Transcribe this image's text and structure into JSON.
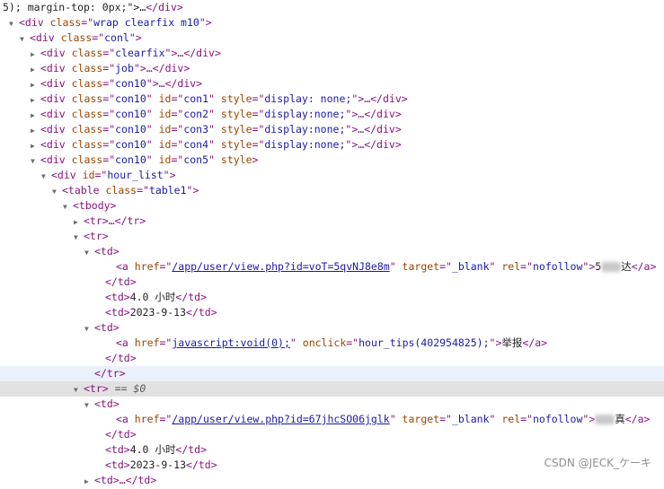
{
  "lines": [
    {
      "indent": 3,
      "tri": "",
      "html": "<span class='txt'>5); margin-top: 0px;\">…</span><span class='tag'>&lt;/div&gt;</span>"
    },
    {
      "indent": 21,
      "tri": "open",
      "html": "<span class='tag'>&lt;div</span> <span class='attr'>class</span>=\"<span class='val'>wrap clearfix m10</span>\"<span class='tag'>&gt;</span>"
    },
    {
      "indent": 33,
      "tri": "open",
      "html": "<span class='tag'>&lt;div</span> <span class='attr'>class</span>=\"<span class='val'>conl</span>\"<span class='tag'>&gt;</span>"
    },
    {
      "indent": 45,
      "tri": "closed",
      "html": "<span class='tag'>&lt;div</span> <span class='attr'>class</span>=\"<span class='val'>clearfix</span>\"<span class='tag'>&gt;</span>…<span class='tag'>&lt;/div&gt;</span>"
    },
    {
      "indent": 45,
      "tri": "closed",
      "html": "<span class='tag'>&lt;div</span> <span class='attr'>class</span>=\"<span class='val'>job</span>\"<span class='tag'>&gt;</span>…<span class='tag'>&lt;/div&gt;</span>"
    },
    {
      "indent": 45,
      "tri": "closed",
      "html": "<span class='tag'>&lt;div</span> <span class='attr'>class</span>=\"<span class='val'>con10</span>\"<span class='tag'>&gt;</span>…<span class='tag'>&lt;/div&gt;</span>"
    },
    {
      "indent": 45,
      "tri": "closed",
      "html": "<span class='tag'>&lt;div</span> <span class='attr'>class</span>=\"<span class='val'>con10</span>\" <span class='attr'>id</span>=\"<span class='val'>con1</span>\" <span class='attr'>style</span>=\"<span class='val'>display: none;</span>\"<span class='tag'>&gt;</span>…<span class='tag'>&lt;/div&gt;</span>"
    },
    {
      "indent": 45,
      "tri": "closed",
      "html": "<span class='tag'>&lt;div</span> <span class='attr'>class</span>=\"<span class='val'>con10</span>\" <span class='attr'>id</span>=\"<span class='val'>con2</span>\" <span class='attr'>style</span>=\"<span class='val'>display:none;</span>\"<span class='tag'>&gt;</span>…<span class='tag'>&lt;/div&gt;</span>"
    },
    {
      "indent": 45,
      "tri": "closed",
      "html": "<span class='tag'>&lt;div</span> <span class='attr'>class</span>=\"<span class='val'>con10</span>\" <span class='attr'>id</span>=\"<span class='val'>con3</span>\" <span class='attr'>style</span>=\"<span class='val'>display:none;</span>\"<span class='tag'>&gt;</span>…<span class='tag'>&lt;/div&gt;</span>"
    },
    {
      "indent": 45,
      "tri": "closed",
      "html": "<span class='tag'>&lt;div</span> <span class='attr'>class</span>=\"<span class='val'>con10</span>\" <span class='attr'>id</span>=\"<span class='val'>con4</span>\" <span class='attr'>style</span>=\"<span class='val'>display:none;</span>\"<span class='tag'>&gt;</span>…<span class='tag'>&lt;/div&gt;</span>"
    },
    {
      "indent": 45,
      "tri": "open",
      "html": "<span class='tag'>&lt;div</span> <span class='attr'>class</span>=\"<span class='val'>con10</span>\" <span class='attr'>id</span>=\"<span class='val'>con5</span>\" <span class='attr'>style</span><span class='tag'>&gt;</span>"
    },
    {
      "indent": 57,
      "tri": "open",
      "html": "<span class='tag'>&lt;div</span> <span class='attr'>id</span>=\"<span class='val'>hour_list</span>\"<span class='tag'>&gt;</span>"
    },
    {
      "indent": 69,
      "tri": "open",
      "html": "<span class='tag'>&lt;table</span> <span class='attr'>class</span>=\"<span class='val'>table1</span>\"<span class='tag'>&gt;</span>"
    },
    {
      "indent": 81,
      "tri": "open",
      "html": "<span class='tag'>&lt;tbody&gt;</span>"
    },
    {
      "indent": 93,
      "tri": "closed",
      "html": "<span class='tag'>&lt;tr&gt;</span>…<span class='tag'>&lt;/tr&gt;</span>"
    },
    {
      "indent": 93,
      "tri": "open",
      "html": "<span class='tag'>&lt;tr&gt;</span>"
    },
    {
      "indent": 105,
      "tri": "open",
      "html": "<span class='tag'>&lt;td&gt;</span>"
    },
    {
      "indent": 129,
      "tri": "",
      "html": "<span class='tag'>&lt;a</span> <span class='attr'>href</span>=\"<span class='link'>/app/user/view.php?id=voT=5qvNJ8e8m</span>\" <span class='attr'>target</span>=\"<span class='val'>_blank</span>\" <span class='attr'>rel</span>=\"<span class='val'>nofollow</span>\"<span class='tag'>&gt;</span><span class='txt'>5</span><span class='blur'></span><span class='txt'>达</span><span class='tag'>&lt;/a&gt;</span>"
    },
    {
      "indent": 117,
      "tri": "",
      "html": "<span class='tag'>&lt;/td&gt;</span>"
    },
    {
      "indent": 117,
      "tri": "",
      "html": "<span class='tag'>&lt;td&gt;</span><span class='txt'>4.0 小时</span><span class='tag'>&lt;/td&gt;</span>"
    },
    {
      "indent": 117,
      "tri": "",
      "html": "<span class='tag'>&lt;td&gt;</span><span class='txt'>2023-9-13</span><span class='tag'>&lt;/td&gt;</span>"
    },
    {
      "indent": 105,
      "tri": "open",
      "html": "<span class='tag'>&lt;td&gt;</span>"
    },
    {
      "indent": 129,
      "tri": "",
      "html": "<span class='tag'>&lt;a</span> <span class='attr'>href</span>=\"<span class='link'>javascript:void(0);</span>\" <span class='attr'>onclick</span>=\"<span class='val'>hour_tips(402954825);</span>\"<span class='tag'>&gt;</span><span class='txt'>举报</span><span class='tag'>&lt;/a&gt;</span>"
    },
    {
      "indent": 117,
      "tri": "",
      "html": "<span class='tag'>&lt;/td&gt;</span>"
    },
    {
      "indent": 105,
      "tri": "",
      "state": "hover",
      "html": "<span class='tag'>&lt;/tr&gt;</span>"
    },
    {
      "indent": 93,
      "tri": "open",
      "state": "selected",
      "html": "<span class='tag'>&lt;tr&gt;</span> <span class='dim'>== $0</span>"
    },
    {
      "indent": 105,
      "tri": "open",
      "html": "<span class='tag'>&lt;td&gt;</span>"
    },
    {
      "indent": 129,
      "tri": "",
      "html": "<span class='tag'>&lt;a</span> <span class='attr'>href</span>=\"<span class='link'>/app/user/view.php?id=67jhcSO06jglk</span>\" <span class='attr'>target</span>=\"<span class='val'>_blank</span>\" <span class='attr'>rel</span>=\"<span class='val'>nofollow</span>\"<span class='tag'>&gt;</span><span class='blur'></span><span class='txt'>真</span><span class='tag'>&lt;/a&gt;</span>"
    },
    {
      "indent": 117,
      "tri": "",
      "html": "<span class='tag'>&lt;/td&gt;</span>"
    },
    {
      "indent": 117,
      "tri": "",
      "html": "<span class='tag'>&lt;td&gt;</span><span class='txt'>4.0 小时</span><span class='tag'>&lt;/td&gt;</span>"
    },
    {
      "indent": 117,
      "tri": "",
      "html": "<span class='tag'>&lt;td&gt;</span><span class='txt'>2023-9-13</span><span class='tag'>&lt;/td&gt;</span>"
    },
    {
      "indent": 105,
      "tri": "closed",
      "html": "<span class='tag'>&lt;td&gt;</span>…<span class='tag'>&lt;/td&gt;</span>"
    }
  ],
  "watermark": "CSDN @JECK_ケーキ"
}
